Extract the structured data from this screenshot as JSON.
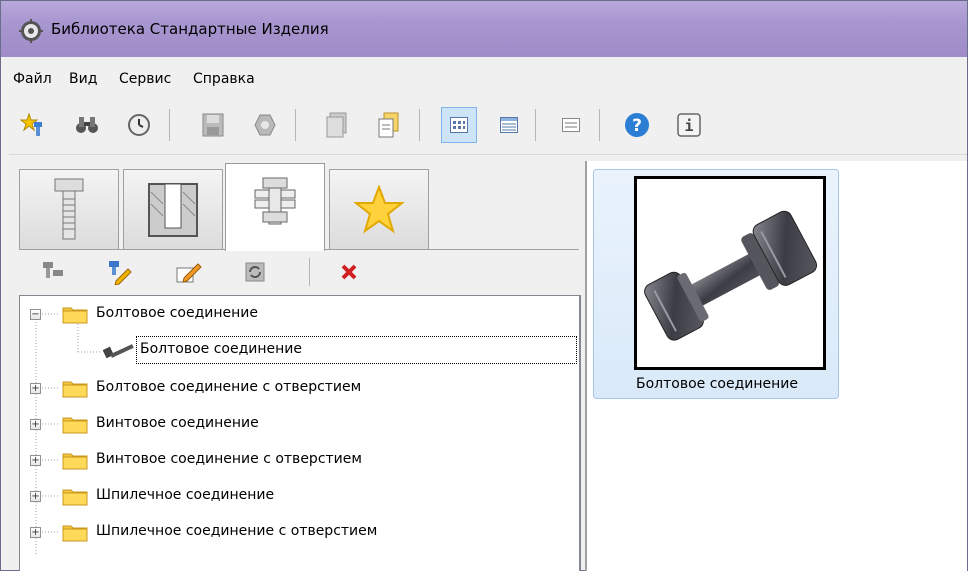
{
  "window": {
    "title": "Библиотека Стандартные Изделия"
  },
  "menu": {
    "file": "Файл",
    "view": "Вид",
    "service": "Сервис",
    "help": "Справка"
  },
  "tree": {
    "items": [
      {
        "label": "Болтовое соединение",
        "expanded": true
      },
      {
        "label": "Болтовое соединение",
        "child": true
      },
      {
        "label": "Болтовое соединение с отверстием"
      },
      {
        "label": "Винтовое соединение"
      },
      {
        "label": "Винтовое соединение с отверстием"
      },
      {
        "label": "Шпилечное соединение"
      },
      {
        "label": "Шпилечное соединение с отверстием"
      }
    ]
  },
  "preview": {
    "label": "Болтовое соединение"
  },
  "colors": {
    "titlebar": "#a896d0",
    "selection": "#cde4f7",
    "folder": "#f4c542"
  }
}
